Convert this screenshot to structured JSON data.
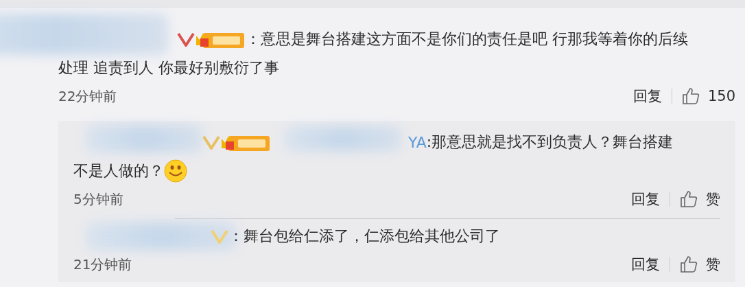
{
  "comment": {
    "separator": "：",
    "text_lines": [
      "意思是舞台搭建这方面不是你们的责任是吧 行那我等着你的后续",
      "处理 追责到人 你最好别敷衍了事"
    ],
    "time": "22分钟前",
    "reply_label": "回复",
    "like_label": "150"
  },
  "replies": [
    {
      "username_fragment": "YA",
      "separator": ":",
      "text_lines": [
        "那意思就是找不到负责人？舞台搭建",
        "不是人做的？"
      ],
      "emoji": true,
      "badge": true,
      "time": "5分钟前",
      "reply_label": "回复",
      "like_label": "赞"
    },
    {
      "separator": "：",
      "text_lines": [
        "舞台包给仁添了，仁添包给其他公司了"
      ],
      "emoji": false,
      "badge": false,
      "time": "21分钟前",
      "reply_label": "回复",
      "like_label": "赞"
    }
  ]
}
